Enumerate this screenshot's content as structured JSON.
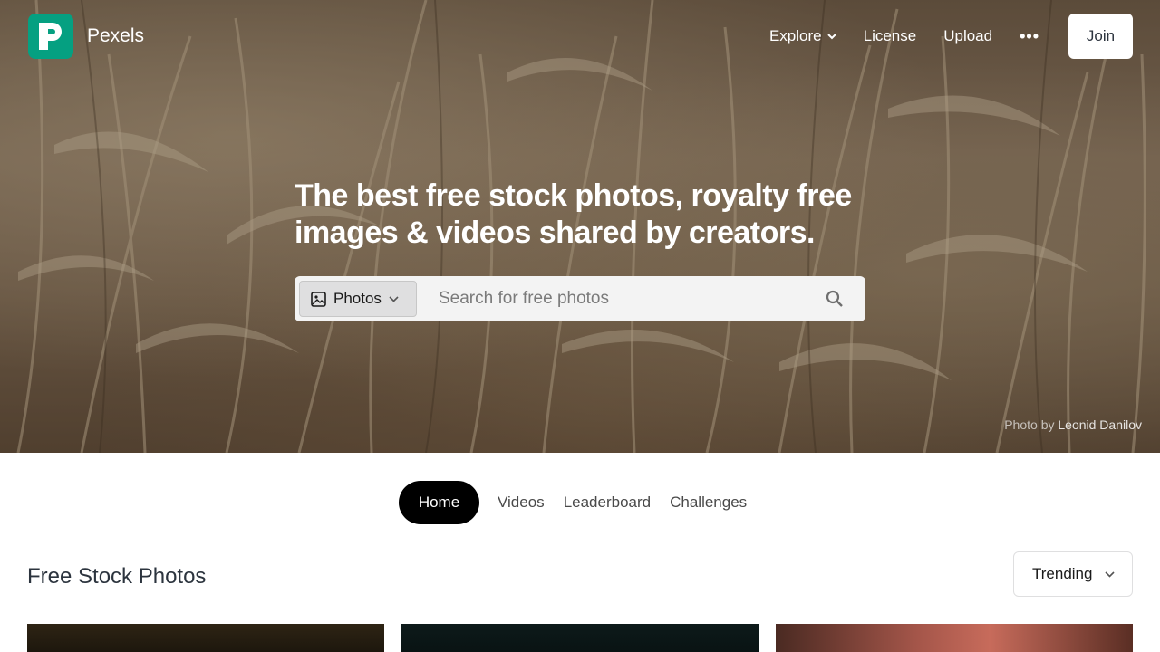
{
  "header": {
    "brand": "Pexels",
    "logo_icon": "pexels-logo-icon",
    "nav": [
      {
        "label": "Explore",
        "has_dropdown": true
      },
      {
        "label": "License"
      },
      {
        "label": "Upload"
      }
    ],
    "more_icon": "ellipsis-icon",
    "join_label": "Join"
  },
  "hero": {
    "headline": "The best free stock photos, royalty free images & videos shared by creators.",
    "search": {
      "type_label": "Photos",
      "type_icon": "image-icon",
      "placeholder": "Search for free photos",
      "search_icon": "search-icon"
    },
    "credit_prefix": "Photo by",
    "credit_author": "Leonid Danilov"
  },
  "tabs": [
    {
      "label": "Home",
      "active": true
    },
    {
      "label": "Videos"
    },
    {
      "label": "Leaderboard"
    },
    {
      "label": "Challenges"
    }
  ],
  "section": {
    "title": "Free Stock Photos",
    "sort_label": "Trending"
  },
  "colors": {
    "brand_green": "#05a081",
    "active_tab": "#000000",
    "text_dark": "#2c343e"
  }
}
